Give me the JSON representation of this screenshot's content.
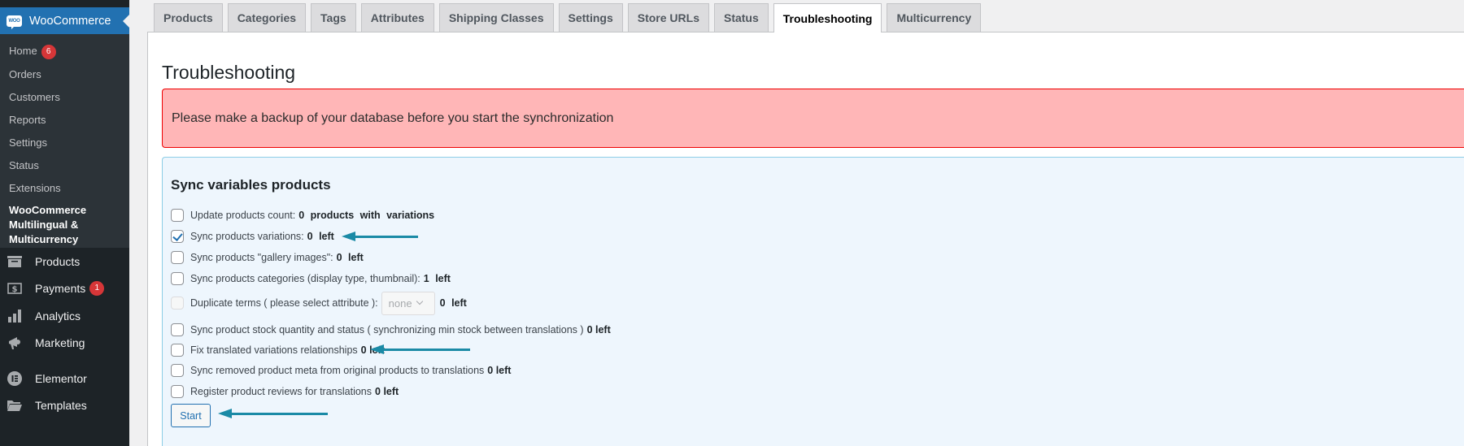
{
  "sidebar": {
    "woocommerce_label": "WooCommerce",
    "woo_logo_text": "WOO",
    "submenu": [
      {
        "label": "Home",
        "badge": "6"
      },
      {
        "label": "Orders"
      },
      {
        "label": "Customers"
      },
      {
        "label": "Reports"
      },
      {
        "label": "Settings"
      },
      {
        "label": "Status"
      },
      {
        "label": "Extensions"
      },
      {
        "label": "WooCommerce Multilingual & Multicurrency",
        "current": true
      }
    ],
    "menu": [
      {
        "label": "Products",
        "icon": "archive-icon"
      },
      {
        "label": "Payments",
        "icon": "dollar-icon",
        "badge": "1"
      },
      {
        "label": "Analytics",
        "icon": "bar-chart-icon"
      },
      {
        "label": "Marketing",
        "icon": "megaphone-icon"
      },
      {
        "label": "Elementor",
        "icon": "elementor-icon"
      },
      {
        "label": "Templates",
        "icon": "folder-icon"
      }
    ]
  },
  "tabs": [
    {
      "label": "Products"
    },
    {
      "label": "Categories"
    },
    {
      "label": "Tags"
    },
    {
      "label": "Attributes"
    },
    {
      "label": "Shipping Classes"
    },
    {
      "label": "Settings"
    },
    {
      "label": "Store URLs"
    },
    {
      "label": "Status"
    },
    {
      "label": "Troubleshooting",
      "active": true
    },
    {
      "label": "Multicurrency"
    }
  ],
  "page": {
    "title": "Troubleshooting",
    "alert": "Please make a backup of your database before you start the synchronization",
    "alert_bg": "#ffb6b7",
    "sync_box": {
      "heading": "Sync variables products",
      "rows": [
        {
          "label": "Update products count:",
          "value": "0  products with variations",
          "checked": false
        },
        {
          "label": "Sync products variations:",
          "value": "0  left",
          "checked": true
        },
        {
          "label": "Sync products \"gallery images\":",
          "value": "0  left",
          "checked": false
        },
        {
          "label": "Sync products categories (display type, thumbnail):",
          "value": "1  left",
          "checked": false
        },
        {
          "label": "Duplicate terms ( please select attribute ):",
          "select_value": "none",
          "value": "0  left",
          "checked": false,
          "disabled": true
        },
        {
          "label": "Sync product stock quantity and status ( synchronizing min stock between translations )",
          "value": "0 left",
          "checked": false
        },
        {
          "label": "Fix translated variations relationships",
          "value": "0 left",
          "checked": false
        },
        {
          "label": "Sync removed product meta from original products to translations",
          "value": "0 left",
          "checked": false
        },
        {
          "label": "Register product reviews for translations",
          "value": "0 left",
          "checked": false
        }
      ],
      "start_label": "Start"
    },
    "annotation_color": "#1a8aa6"
  }
}
